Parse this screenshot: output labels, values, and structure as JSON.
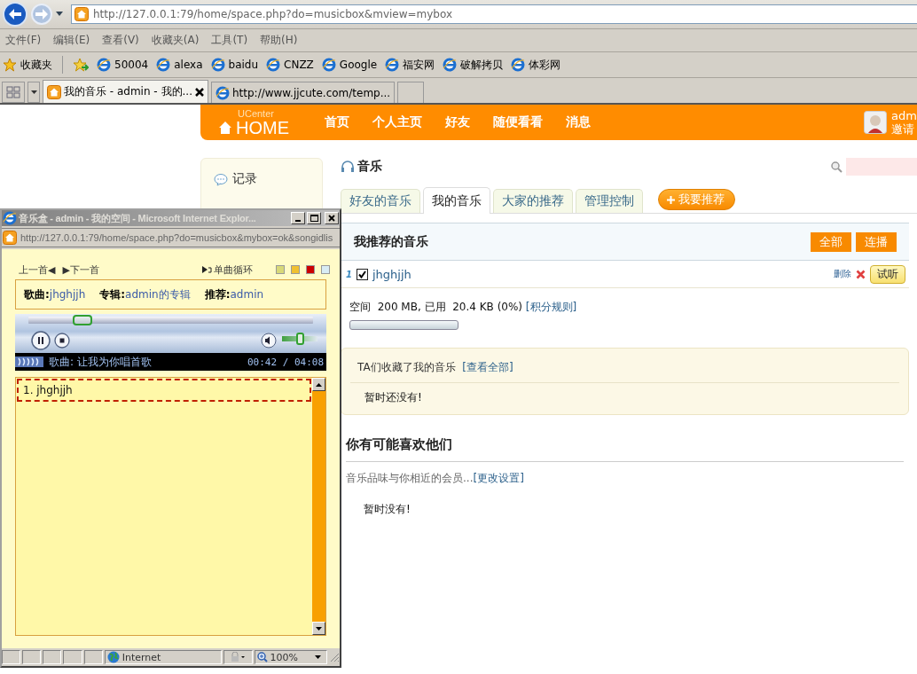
{
  "browser": {
    "url": "http://127.0.0.1:79/home/space.php?do=musicbox&mview=mybox",
    "menu": [
      "文件(F)",
      "编辑(E)",
      "查看(V)",
      "收藏夹(A)",
      "工具(T)",
      "帮助(H)"
    ],
    "favorites_label": "收藏夹",
    "bookmarks": [
      "50004",
      "alexa",
      "baidu",
      "CNZZ",
      "Google",
      "福安网",
      "破解拷贝",
      "体彩网"
    ],
    "tabs": [
      {
        "label": "我的音乐 - admin - 我的...",
        "selected": true
      },
      {
        "label": "http://www.jjcute.com/temp...",
        "selected": false
      }
    ]
  },
  "site": {
    "logo_top": "UCenter",
    "logo": "HOME",
    "nav": [
      "首页",
      "个人主页",
      "好友",
      "随便看看",
      "消息"
    ],
    "user": "adm",
    "invite": "邀请"
  },
  "sidebar": {
    "items": [
      "记录"
    ]
  },
  "music": {
    "title": "音乐",
    "tabs": [
      {
        "label": "好友的音乐",
        "selected": false
      },
      {
        "label": "我的音乐",
        "selected": true
      },
      {
        "label": "大家的推荐",
        "selected": false
      },
      {
        "label": "管理控制",
        "selected": false
      }
    ],
    "recommend_button": "我要推荐",
    "section_title": "我推荐的音乐",
    "actions": [
      "全部",
      "连播"
    ],
    "songs": [
      {
        "index": "1",
        "title": "jhghjjh",
        "checked": true,
        "delete": "删除",
        "listen": "试听"
      }
    ],
    "space": {
      "text": "空间  200 MB, 已用  20.4 KB (0%)",
      "link": "[积分规则]",
      "level": 0
    },
    "collected": {
      "title": "TA们收藏了我的音乐",
      "link": "[查看全部]",
      "empty": "暂时还没有!"
    },
    "suggest": {
      "title": "你有可能喜欢他们",
      "text": "音乐品味与你相近的会员...",
      "link": "[更改设置]",
      "empty": "暂时没有!"
    }
  },
  "popup": {
    "title": "音乐盒 - admin - 我的空间 - Microsoft Internet Explor...",
    "url": "http://127.0.0.1:79/home/space.php?do=musicbox&mybox=ok&songidlis",
    "prev": "上一首◀",
    "next": "▶下一首",
    "loop": "单曲循环",
    "swatches": [
      {
        "color": "#d8d878"
      },
      {
        "color": "#f0c030"
      },
      {
        "color": "#cc0000"
      },
      {
        "color": "#d8ecf4"
      }
    ],
    "info": [
      {
        "label": "歌曲:",
        "value": "jhghjjh"
      },
      {
        "label": "专辑:",
        "value": "admin的专辑"
      },
      {
        "label": "推荐:",
        "value": "admin"
      }
    ],
    "player": {
      "progress": {
        "level": 0.19
      },
      "volume": {
        "level": 0.5
      },
      "now_playing": "歌曲: 让我为你唱首歌",
      "time": "00:42 / 04:08"
    },
    "playlist": [
      {
        "label": "1. jhghjjh",
        "selected": true
      }
    ],
    "status": {
      "zone": "Internet",
      "zoom": "100%"
    }
  }
}
